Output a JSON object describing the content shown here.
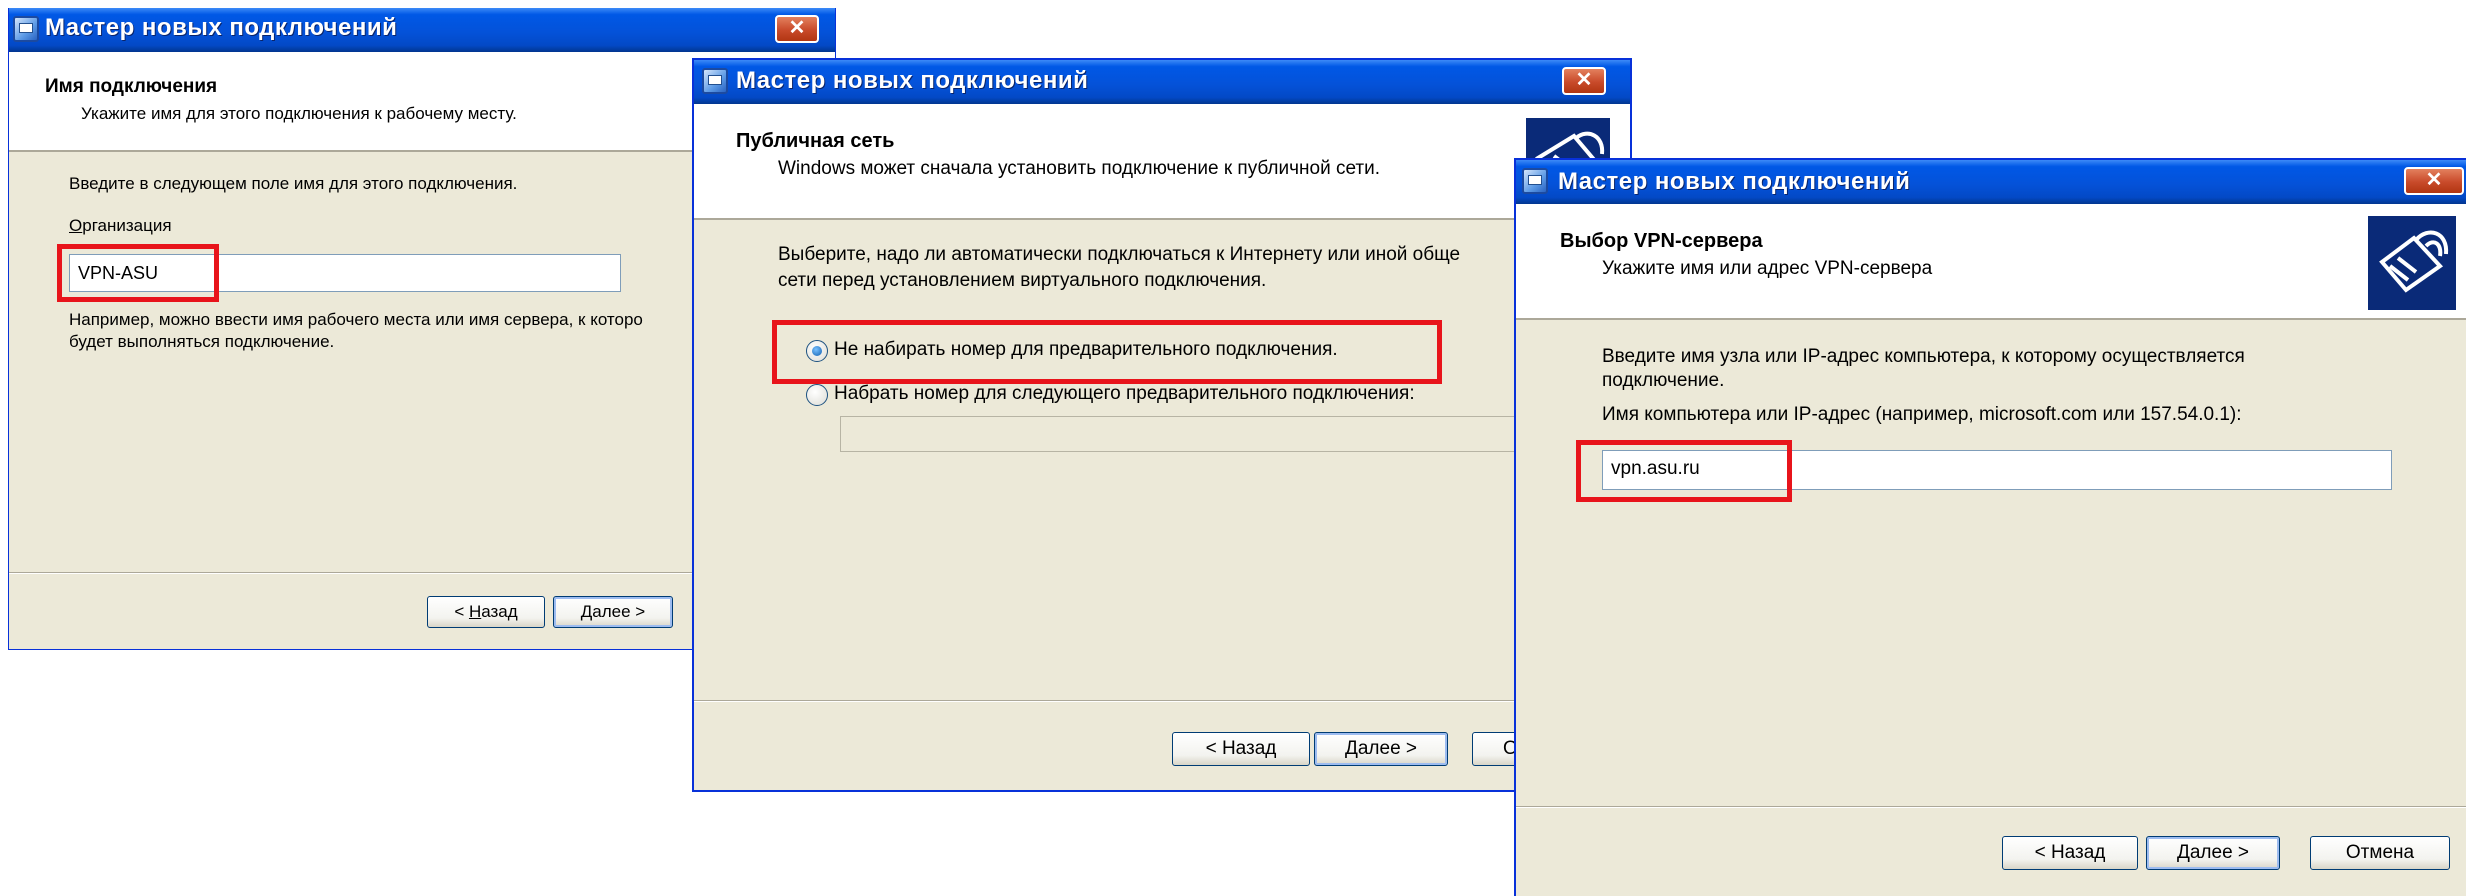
{
  "dialog1": {
    "title": "Мастер новых подключений",
    "close": "✕",
    "header_title": "Имя подключения",
    "header_subtitle": "Укажите имя для этого подключения к рабочему месту.",
    "instruction": "Введите в следующем поле имя для этого подключения.",
    "field_label_first": "О",
    "field_label_rest": "рганизация",
    "field_value": "VPN-ASU",
    "hint_line1": "Например, можно ввести имя рабочего места или имя сервера, к которо",
    "hint_line2": "будет выполняться подключение.",
    "back_pre": "< ",
    "back_key": "Н",
    "back_rest": "азад",
    "next_key": "Д",
    "next_rest": "алее >"
  },
  "dialog2": {
    "title": "Мастер новых подключений",
    "close": "✕",
    "header_title": "Публичная сеть",
    "header_subtitle": "Windows может сначала установить подключение к публичной сети.",
    "instruction_line1": "Выберите, надо ли автоматически подключаться к Интернету или иной обще",
    "instruction_line2": "сети перед установлением виртуального подключения.",
    "option1": "Не набирать номер для предварительного подключения.",
    "option2": "Набрать номер для следующего предварительного подключения:",
    "back": "< Назад",
    "next": "Далее >",
    "cancel_partial": "О"
  },
  "dialog3": {
    "title": "Мастер новых подключений",
    "close": "✕",
    "header_title": "Выбор VPN-сервера",
    "header_subtitle": "Укажите имя или адрес VPN-сервера",
    "instruction_line1": "Введите имя узла или IP-адрес компьютера, к  которому осуществляется",
    "instruction_line2": "подключение.",
    "field_label": "Имя компьютера или IP-адрес (например, microsoft.com или 157.54.0.1):",
    "field_value": "vpn.asu.ru",
    "back": "< Назад",
    "next": "Далее >",
    "cancel": "Отмена"
  },
  "colors": {
    "titlebar": "#0452d9",
    "dialog_bg": "#ece9d8",
    "highlight_box": "#e8141b",
    "close_button": "#c84a2a"
  }
}
